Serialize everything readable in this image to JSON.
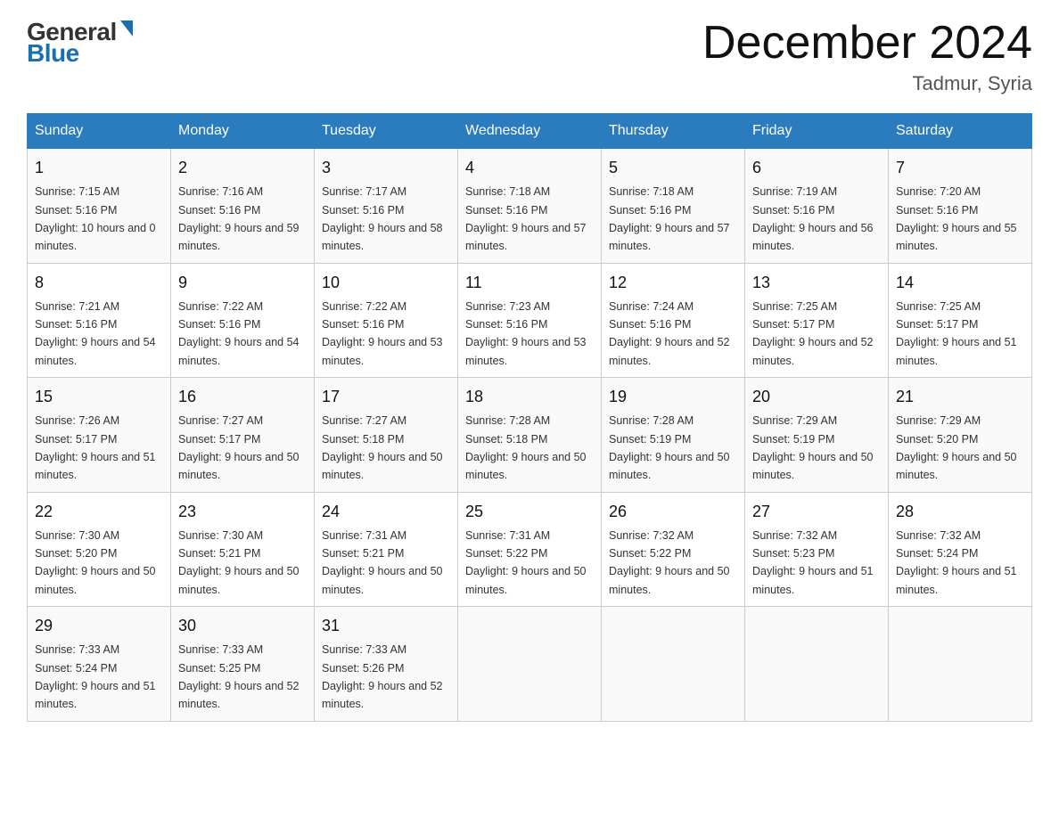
{
  "header": {
    "logo_general": "General",
    "logo_blue": "Blue",
    "month_title": "December 2024",
    "location": "Tadmur, Syria"
  },
  "days_of_week": [
    "Sunday",
    "Monday",
    "Tuesday",
    "Wednesday",
    "Thursday",
    "Friday",
    "Saturday"
  ],
  "weeks": [
    [
      {
        "day": "1",
        "sunrise": "7:15 AM",
        "sunset": "5:16 PM",
        "daylight": "10 hours and 0 minutes."
      },
      {
        "day": "2",
        "sunrise": "7:16 AM",
        "sunset": "5:16 PM",
        "daylight": "9 hours and 59 minutes."
      },
      {
        "day": "3",
        "sunrise": "7:17 AM",
        "sunset": "5:16 PM",
        "daylight": "9 hours and 58 minutes."
      },
      {
        "day": "4",
        "sunrise": "7:18 AM",
        "sunset": "5:16 PM",
        "daylight": "9 hours and 57 minutes."
      },
      {
        "day": "5",
        "sunrise": "7:18 AM",
        "sunset": "5:16 PM",
        "daylight": "9 hours and 57 minutes."
      },
      {
        "day": "6",
        "sunrise": "7:19 AM",
        "sunset": "5:16 PM",
        "daylight": "9 hours and 56 minutes."
      },
      {
        "day": "7",
        "sunrise": "7:20 AM",
        "sunset": "5:16 PM",
        "daylight": "9 hours and 55 minutes."
      }
    ],
    [
      {
        "day": "8",
        "sunrise": "7:21 AM",
        "sunset": "5:16 PM",
        "daylight": "9 hours and 54 minutes."
      },
      {
        "day": "9",
        "sunrise": "7:22 AM",
        "sunset": "5:16 PM",
        "daylight": "9 hours and 54 minutes."
      },
      {
        "day": "10",
        "sunrise": "7:22 AM",
        "sunset": "5:16 PM",
        "daylight": "9 hours and 53 minutes."
      },
      {
        "day": "11",
        "sunrise": "7:23 AM",
        "sunset": "5:16 PM",
        "daylight": "9 hours and 53 minutes."
      },
      {
        "day": "12",
        "sunrise": "7:24 AM",
        "sunset": "5:16 PM",
        "daylight": "9 hours and 52 minutes."
      },
      {
        "day": "13",
        "sunrise": "7:25 AM",
        "sunset": "5:17 PM",
        "daylight": "9 hours and 52 minutes."
      },
      {
        "day": "14",
        "sunrise": "7:25 AM",
        "sunset": "5:17 PM",
        "daylight": "9 hours and 51 minutes."
      }
    ],
    [
      {
        "day": "15",
        "sunrise": "7:26 AM",
        "sunset": "5:17 PM",
        "daylight": "9 hours and 51 minutes."
      },
      {
        "day": "16",
        "sunrise": "7:27 AM",
        "sunset": "5:17 PM",
        "daylight": "9 hours and 50 minutes."
      },
      {
        "day": "17",
        "sunrise": "7:27 AM",
        "sunset": "5:18 PM",
        "daylight": "9 hours and 50 minutes."
      },
      {
        "day": "18",
        "sunrise": "7:28 AM",
        "sunset": "5:18 PM",
        "daylight": "9 hours and 50 minutes."
      },
      {
        "day": "19",
        "sunrise": "7:28 AM",
        "sunset": "5:19 PM",
        "daylight": "9 hours and 50 minutes."
      },
      {
        "day": "20",
        "sunrise": "7:29 AM",
        "sunset": "5:19 PM",
        "daylight": "9 hours and 50 minutes."
      },
      {
        "day": "21",
        "sunrise": "7:29 AM",
        "sunset": "5:20 PM",
        "daylight": "9 hours and 50 minutes."
      }
    ],
    [
      {
        "day": "22",
        "sunrise": "7:30 AM",
        "sunset": "5:20 PM",
        "daylight": "9 hours and 50 minutes."
      },
      {
        "day": "23",
        "sunrise": "7:30 AM",
        "sunset": "5:21 PM",
        "daylight": "9 hours and 50 minutes."
      },
      {
        "day": "24",
        "sunrise": "7:31 AM",
        "sunset": "5:21 PM",
        "daylight": "9 hours and 50 minutes."
      },
      {
        "day": "25",
        "sunrise": "7:31 AM",
        "sunset": "5:22 PM",
        "daylight": "9 hours and 50 minutes."
      },
      {
        "day": "26",
        "sunrise": "7:32 AM",
        "sunset": "5:22 PM",
        "daylight": "9 hours and 50 minutes."
      },
      {
        "day": "27",
        "sunrise": "7:32 AM",
        "sunset": "5:23 PM",
        "daylight": "9 hours and 51 minutes."
      },
      {
        "day": "28",
        "sunrise": "7:32 AM",
        "sunset": "5:24 PM",
        "daylight": "9 hours and 51 minutes."
      }
    ],
    [
      {
        "day": "29",
        "sunrise": "7:33 AM",
        "sunset": "5:24 PM",
        "daylight": "9 hours and 51 minutes."
      },
      {
        "day": "30",
        "sunrise": "7:33 AM",
        "sunset": "5:25 PM",
        "daylight": "9 hours and 52 minutes."
      },
      {
        "day": "31",
        "sunrise": "7:33 AM",
        "sunset": "5:26 PM",
        "daylight": "9 hours and 52 minutes."
      },
      null,
      null,
      null,
      null
    ]
  ],
  "colors": {
    "header_bg": "#2b7bbf",
    "header_text": "#ffffff",
    "accent_blue": "#1a6faf"
  }
}
